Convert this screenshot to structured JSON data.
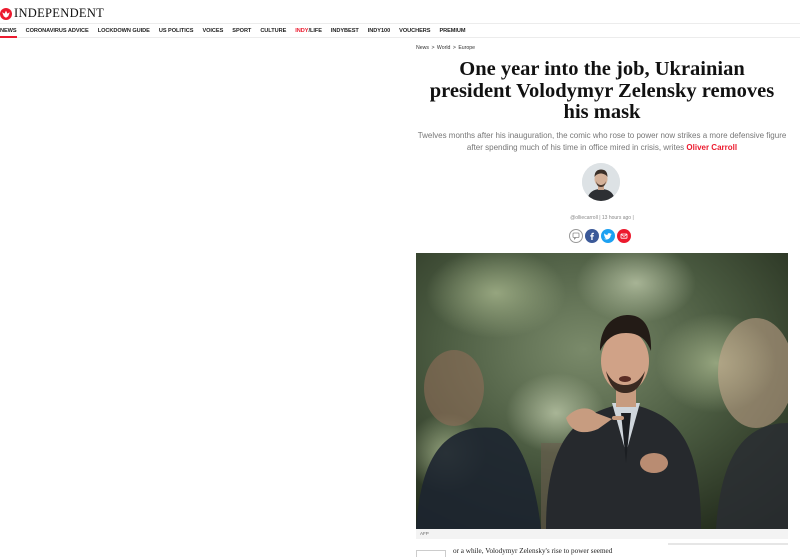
{
  "header": {
    "logo_text": "INDEPENDENT"
  },
  "nav": {
    "items": [
      {
        "label": "NEWS"
      },
      {
        "label": "CORONAVIRUS ADVICE"
      },
      {
        "label": "LOCKDOWN GUIDE"
      },
      {
        "label": "US POLITICS"
      },
      {
        "label": "VOICES"
      },
      {
        "label": "SPORT"
      },
      {
        "label": "CULTURE"
      },
      {
        "label_red": "INDY",
        "label_rest": "/LIFE"
      },
      {
        "label": "INDYBEST"
      },
      {
        "label": "INDY100"
      },
      {
        "label": "VOUCHERS"
      },
      {
        "label": "PREMIUM"
      }
    ]
  },
  "breadcrumb": {
    "items": [
      "News",
      "World",
      "Europe"
    ],
    "separator": ">"
  },
  "article": {
    "headline": "One year into the job, Ukrainian president Volodymyr Zelensky removes his mask",
    "standfirst": "Twelves months after his inauguration, the comic who rose to power now strikes a more defensive figure after spending much of his time in office mired in crisis, writes",
    "author": "Oliver Carroll",
    "byline": "@olliecarroll | 13 hours ago |",
    "photo_credit": "AFP",
    "body_snippet": "or a while, Volodymyr Zelensky's rise to power seemed"
  },
  "icons": {
    "comment": "comment-icon",
    "facebook": "facebook-icon",
    "twitter": "twitter-icon",
    "email": "email-icon"
  },
  "colors": {
    "brand_red": "#ec1a2e",
    "facebook": "#3b5998",
    "twitter": "#1da1f2"
  }
}
